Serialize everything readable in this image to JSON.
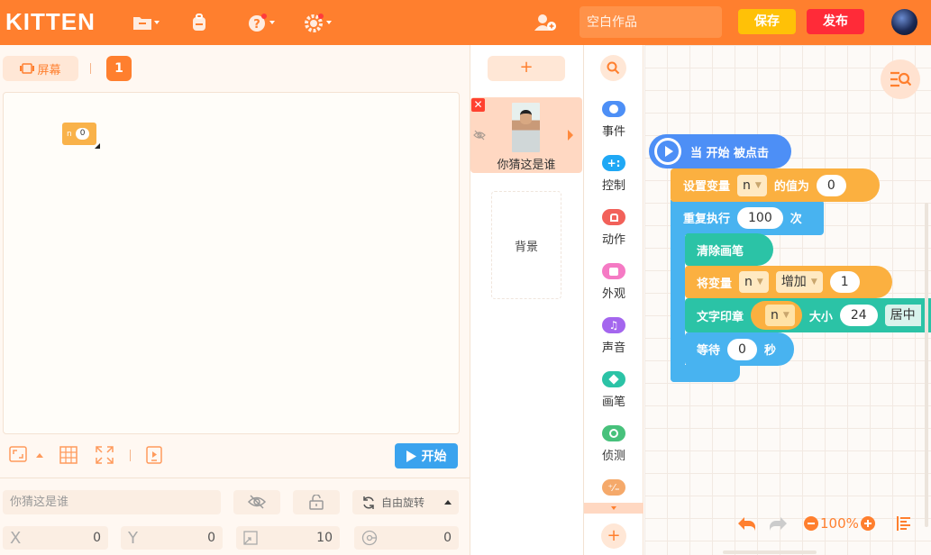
{
  "topbar": {
    "logo": "KITTEN",
    "title_placeholder": "空白作品",
    "save_label": "保存",
    "publish_label": "发布",
    "colors": {
      "bar": "#ff7f2e",
      "save": "#ffc107",
      "publish": "#ff2b38"
    }
  },
  "stage": {
    "screen_label": "屏幕",
    "page_number": "1",
    "variable_monitor": {
      "name": "n",
      "value": "0"
    },
    "start_label": "开始"
  },
  "sprite_props": {
    "name_placeholder": "你猜这是谁",
    "rotation_label": "自由旋转",
    "x_label": "X",
    "x_value": "0",
    "y_label": "Y",
    "y_value": "0",
    "size_value": "10",
    "direction_value": "0"
  },
  "sprites": {
    "add_label": "+",
    "selected_name": "你猜这是谁",
    "background_label": "背景"
  },
  "categories": [
    {
      "label": "事件",
      "color": "#4d8ff6"
    },
    {
      "label": "控制",
      "color": "#1fa8f5"
    },
    {
      "label": "动作",
      "color": "#f2615a"
    },
    {
      "label": "外观",
      "color": "#f57ac4"
    },
    {
      "label": "声音",
      "color": "#a466ee"
    },
    {
      "label": "画笔",
      "color": "#2bc3a6"
    },
    {
      "label": "侦测",
      "color": "#47c17b"
    },
    {
      "label": "",
      "color": "#f5a96a"
    }
  ],
  "blocks": {
    "hat": "当 开始 被点击",
    "set_var": {
      "prefix": "设置变量",
      "var": "n",
      "mid": "的值为",
      "value": "0"
    },
    "repeat": {
      "prefix": "重复执行",
      "value": "100",
      "suffix": "次"
    },
    "clear_pen": "清除画笔",
    "change_var": {
      "prefix": "将变量",
      "var": "n",
      "op": "增加",
      "value": "1"
    },
    "stamp_text": {
      "prefix": "文字印章",
      "var": "n",
      "size_label": "大小",
      "size": "24",
      "align": "居中"
    },
    "wait": {
      "prefix": "等待",
      "value": "0",
      "suffix": "秒"
    }
  },
  "zoom": {
    "level": "100%"
  }
}
